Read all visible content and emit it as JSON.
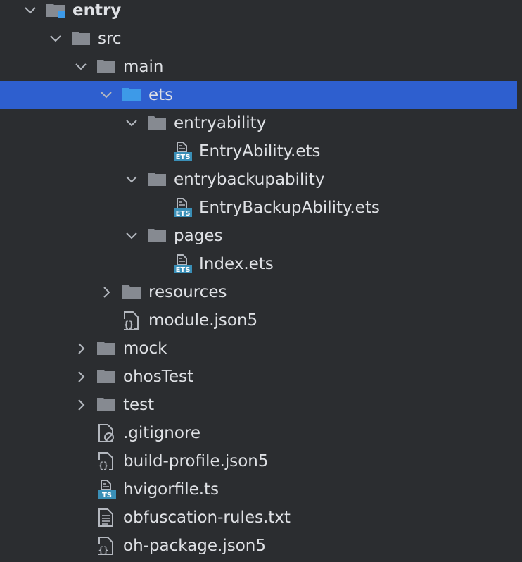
{
  "colors": {
    "background": "#2b2d30",
    "selection": "#2e5fcf",
    "text": "#dfe1e5",
    "folder": "#868a91",
    "source_folder": "#3d9ae8",
    "ets_badge": "#3a8fb7",
    "ts_badge": "#3a8fb7"
  },
  "tree": [
    {
      "label": "entry",
      "depth": 0,
      "icon": "module-folder-icon",
      "chevron": "expanded",
      "bold": true,
      "selected": false
    },
    {
      "label": "src",
      "depth": 1,
      "icon": "folder-icon",
      "chevron": "expanded",
      "bold": false,
      "selected": false
    },
    {
      "label": "main",
      "depth": 2,
      "icon": "folder-icon",
      "chevron": "expanded",
      "bold": false,
      "selected": false
    },
    {
      "label": "ets",
      "depth": 3,
      "icon": "source-folder-icon",
      "chevron": "expanded",
      "bold": false,
      "selected": true
    },
    {
      "label": "entryability",
      "depth": 4,
      "icon": "folder-icon",
      "chevron": "expanded",
      "bold": false,
      "selected": false
    },
    {
      "label": "EntryAbility.ets",
      "depth": 5,
      "icon": "ets-file-icon",
      "chevron": "none",
      "bold": false,
      "selected": false
    },
    {
      "label": "entrybackupability",
      "depth": 4,
      "icon": "folder-icon",
      "chevron": "expanded",
      "bold": false,
      "selected": false
    },
    {
      "label": "EntryBackupAbility.ets",
      "depth": 5,
      "icon": "ets-file-icon",
      "chevron": "none",
      "bold": false,
      "selected": false
    },
    {
      "label": "pages",
      "depth": 4,
      "icon": "folder-icon",
      "chevron": "expanded",
      "bold": false,
      "selected": false
    },
    {
      "label": "Index.ets",
      "depth": 5,
      "icon": "ets-file-icon",
      "chevron": "none",
      "bold": false,
      "selected": false
    },
    {
      "label": "resources",
      "depth": 3,
      "icon": "folder-icon",
      "chevron": "collapsed",
      "bold": false,
      "selected": false
    },
    {
      "label": "module.json5",
      "depth": 3,
      "icon": "json-file-icon",
      "chevron": "none",
      "bold": false,
      "selected": false
    },
    {
      "label": "mock",
      "depth": 2,
      "icon": "folder-icon",
      "chevron": "collapsed",
      "bold": false,
      "selected": false
    },
    {
      "label": "ohosTest",
      "depth": 2,
      "icon": "folder-icon",
      "chevron": "collapsed",
      "bold": false,
      "selected": false
    },
    {
      "label": "test",
      "depth": 2,
      "icon": "folder-icon",
      "chevron": "collapsed",
      "bold": false,
      "selected": false
    },
    {
      "label": ".gitignore",
      "depth": 2,
      "icon": "ignored-file-icon",
      "chevron": "none",
      "bold": false,
      "selected": false
    },
    {
      "label": "build-profile.json5",
      "depth": 2,
      "icon": "json-file-icon",
      "chevron": "none",
      "bold": false,
      "selected": false
    },
    {
      "label": "hvigorfile.ts",
      "depth": 2,
      "icon": "ts-file-icon",
      "chevron": "none",
      "bold": false,
      "selected": false
    },
    {
      "label": "obfuscation-rules.txt",
      "depth": 2,
      "icon": "text-file-icon",
      "chevron": "none",
      "bold": false,
      "selected": false
    },
    {
      "label": "oh-package.json5",
      "depth": 2,
      "icon": "json-file-icon",
      "chevron": "none",
      "bold": false,
      "selected": false
    }
  ]
}
